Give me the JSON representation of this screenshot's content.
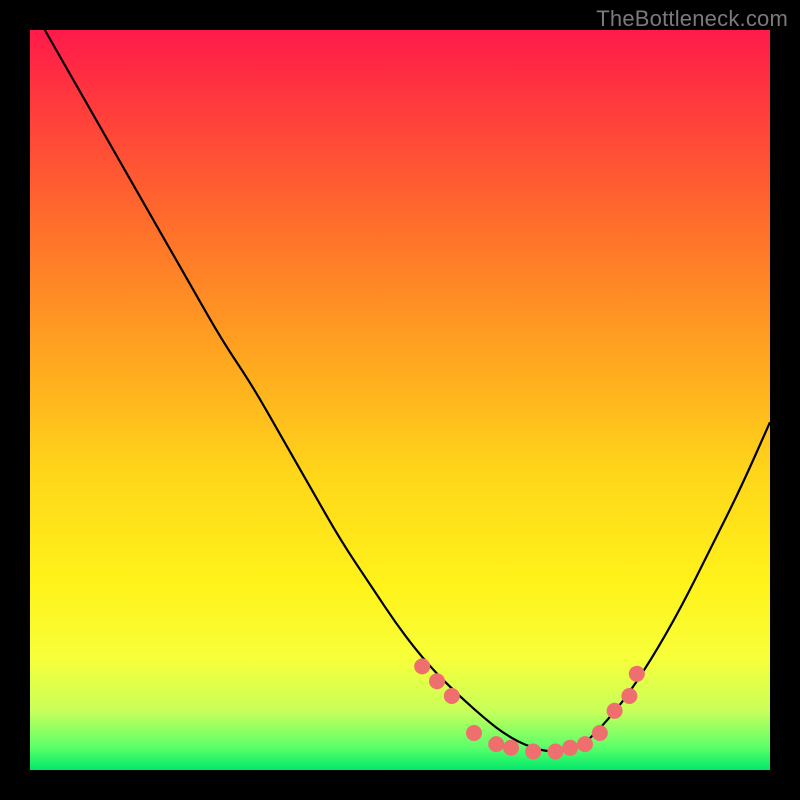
{
  "watermark": "TheBottleneck.com",
  "chart_data": {
    "type": "line",
    "title": "",
    "xlabel": "",
    "ylabel": "",
    "xlim": [
      0,
      100
    ],
    "ylim": [
      0,
      100
    ],
    "grid": false,
    "series": [
      {
        "name": "curve",
        "color": "#000000",
        "x": [
          2,
          6,
          10,
          14,
          18,
          22,
          26,
          30,
          34,
          38,
          42,
          46,
          50,
          54,
          58,
          62,
          64,
          66,
          68,
          70,
          72,
          74,
          76,
          80,
          84,
          88,
          92,
          96,
          100
        ],
        "y": [
          100,
          93,
          86,
          79,
          72,
          65,
          58,
          52,
          45,
          38,
          31,
          25,
          19,
          14,
          10,
          6.5,
          5,
          3.8,
          3,
          2.5,
          2.5,
          3,
          4.5,
          9,
          15,
          22,
          30,
          38,
          47
        ]
      }
    ],
    "markers": {
      "color": "#ef6f6f",
      "radius": 8,
      "points": [
        {
          "x": 53,
          "y": 14
        },
        {
          "x": 55,
          "y": 12
        },
        {
          "x": 57,
          "y": 10
        },
        {
          "x": 60,
          "y": 5
        },
        {
          "x": 63,
          "y": 3.5
        },
        {
          "x": 65,
          "y": 3
        },
        {
          "x": 68,
          "y": 2.5
        },
        {
          "x": 71,
          "y": 2.5
        },
        {
          "x": 73,
          "y": 3
        },
        {
          "x": 75,
          "y": 3.5
        },
        {
          "x": 77,
          "y": 5
        },
        {
          "x": 79,
          "y": 8
        },
        {
          "x": 81,
          "y": 10
        },
        {
          "x": 82,
          "y": 13
        }
      ]
    },
    "annotations": []
  }
}
